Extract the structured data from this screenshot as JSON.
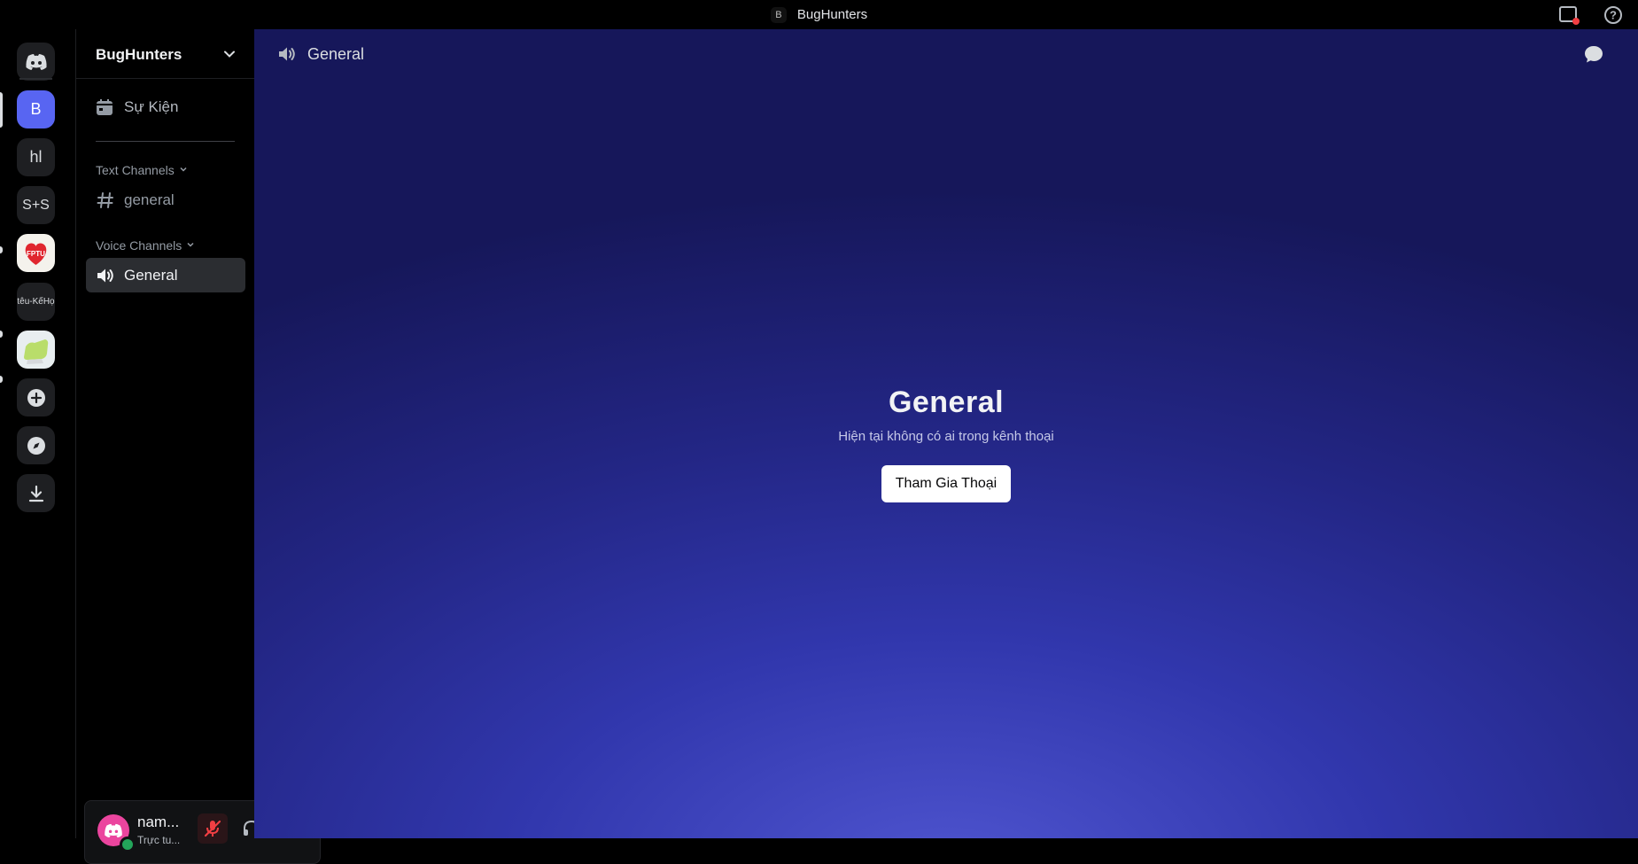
{
  "titlebar": {
    "badge": "B",
    "title": "BugHunters"
  },
  "guilds": {
    "items": [
      {
        "label": "B",
        "selected": true
      },
      {
        "label": "hl"
      },
      {
        "label": "S+S"
      },
      {
        "label": "FPTU",
        "type": "image-icon"
      },
      {
        "label": "têu-KếHọ"
      },
      {
        "label": "",
        "type": "image-icon"
      }
    ],
    "actions": [
      "add-server-icon",
      "discover-icon",
      "download-icon"
    ]
  },
  "sidebar": {
    "server_name": "BugHunters",
    "events_label": "Sự Kiện",
    "text_category": "Text Channels",
    "text_channels": [
      "general"
    ],
    "voice_category": "Voice Channels",
    "voice_channels": [
      "General"
    ]
  },
  "user": {
    "name": "nam...",
    "status": "Trực tu..."
  },
  "main": {
    "channel_name": "General",
    "voice_title": "General",
    "voice_subtitle": "Hiện tại không có ai trong kênh thoại",
    "join_button": "Tham Gia Thoại"
  },
  "colors": {
    "accent": "#5865f2",
    "online": "#23a55a",
    "mute": "#f23f43"
  }
}
